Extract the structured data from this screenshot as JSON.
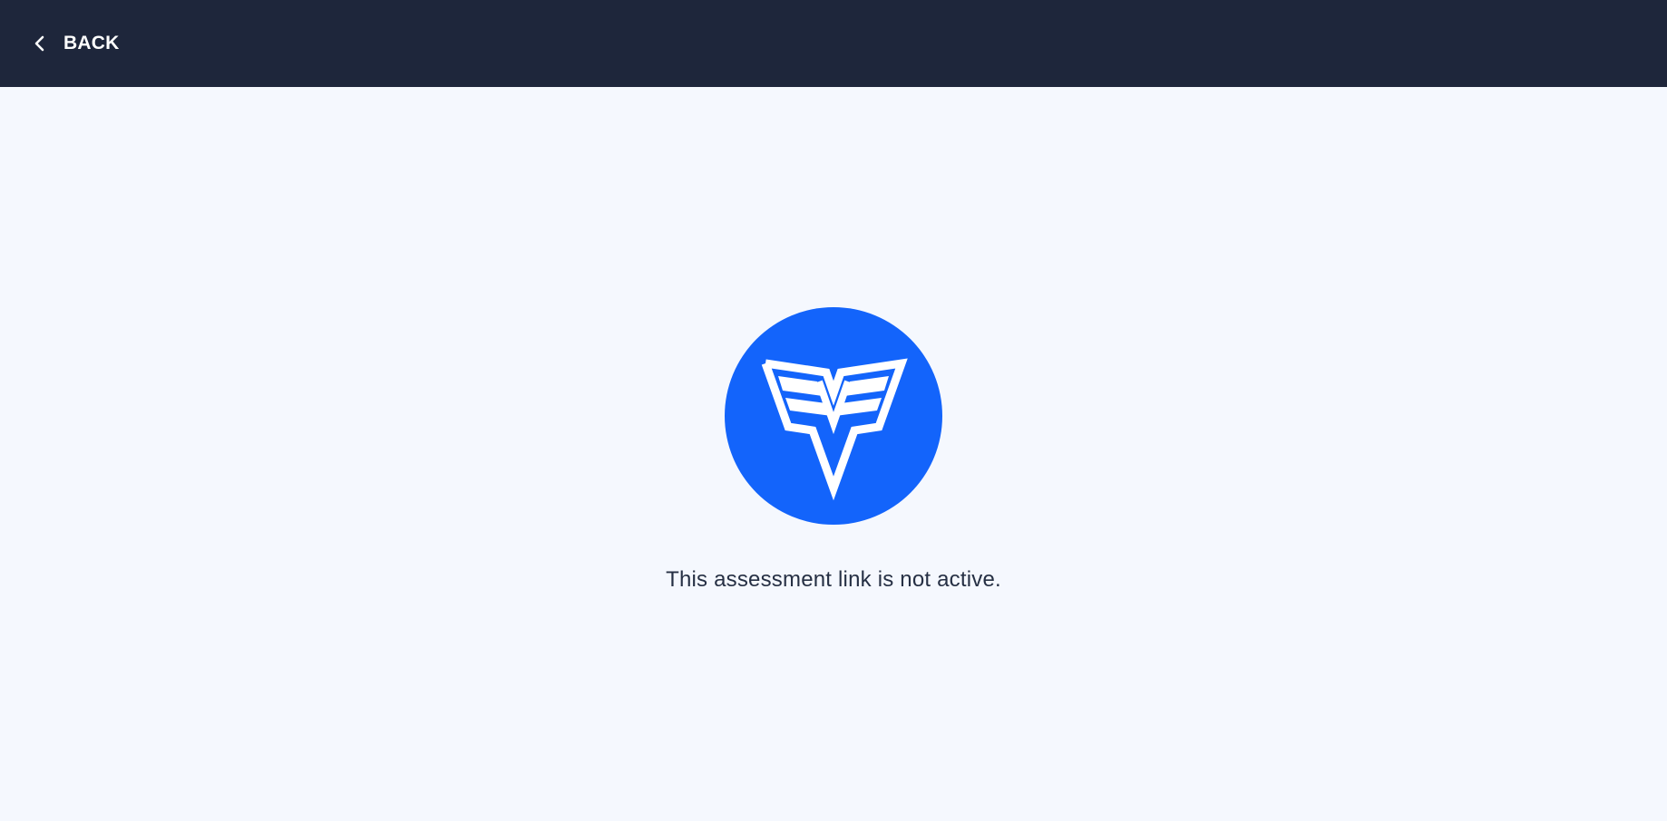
{
  "header": {
    "back_label": "BACK",
    "back_icon": "chevron-left-icon"
  },
  "main": {
    "logo_icon": "brand-logo-icon",
    "message": "This assessment link is not active."
  },
  "colors": {
    "header_bg": "#1e263b",
    "page_bg": "#f5f8fe",
    "brand_blue": "#1364fb",
    "message_text": "#263044"
  }
}
